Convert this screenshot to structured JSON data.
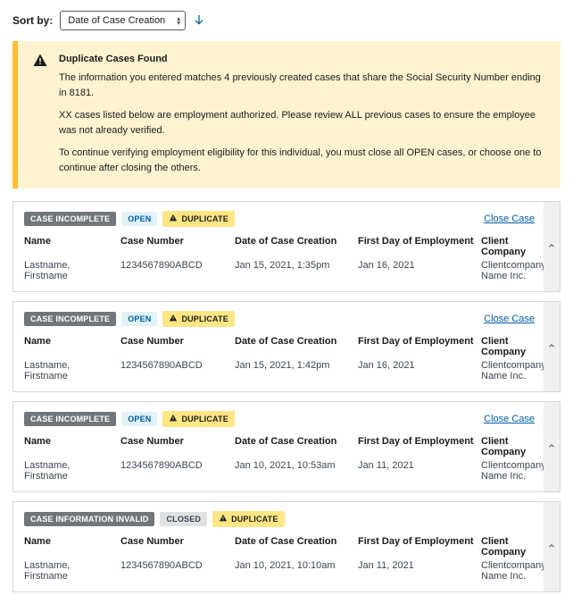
{
  "sort": {
    "label": "Sort by:",
    "selected": "Date of Case Creation"
  },
  "alert": {
    "title": "Duplicate Cases Found",
    "p1": "The information you entered matches 4 previously created cases that share the Social Security Number ending in 8181.",
    "p2": "XX cases listed below are employment authorized. Please review ALL previous cases to ensure the employee was not already verified.",
    "p3": "To continue verifying employment eligibility for this individual, you must close all OPEN cases, or choose one to continue after closing the others."
  },
  "labels": {
    "close_case": "Close Case",
    "duplicate": "DUPLICATE",
    "open": "OPEN",
    "closed": "CLOSED",
    "case_incomplete": "CASE INCOMPLETE",
    "case_info_invalid": "CASE INFORMATION INVALID"
  },
  "columns": {
    "name": "Name",
    "case_number": "Case Number",
    "date_created": "Date of Case Creation",
    "first_day": "First Day of Employment",
    "client_company": "Client Company"
  },
  "cases": [
    {
      "status": "CASE INCOMPLETE",
      "state": "OPEN",
      "name": "Lastname, Firstname",
      "case_number": "1234567890ABCD",
      "date_created": "Jan 15, 2021, 1:35pm",
      "first_day": "Jan 16, 2021",
      "client_company": "Clientcompany Name Inc."
    },
    {
      "status": "CASE INCOMPLETE",
      "state": "OPEN",
      "name": "Lastname, Firstname",
      "case_number": "1234567890ABCD",
      "date_created": "Jan 15, 2021, 1:42pm",
      "first_day": "Jan 16, 2021",
      "client_company": "Clientcompany Name Inc."
    },
    {
      "status": "CASE INCOMPLETE",
      "state": "OPEN",
      "name": "Lastname, Firstname",
      "case_number": "1234567890ABCD",
      "date_created": "Jan 10, 2021, 10:53am",
      "first_day": "Jan 11, 2021",
      "client_company": "Clientcompany Name Inc."
    },
    {
      "status": "CASE INFORMATION INVALID",
      "state": "CLOSED",
      "name": "Lastname, Firstname",
      "case_number": "1234567890ABCD",
      "date_created": "Jan 10, 2021, 10:10am",
      "first_day": "Jan 11, 2021",
      "client_company": "Clientcompany Name Inc."
    }
  ]
}
